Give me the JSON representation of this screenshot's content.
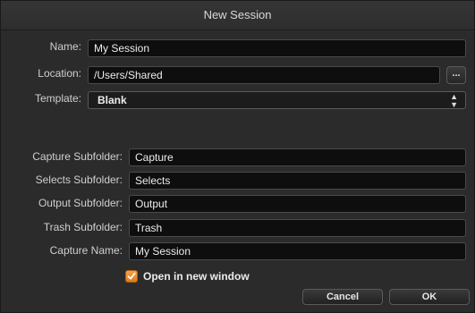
{
  "dialog": {
    "title": "New Session"
  },
  "form": {
    "name_label": "Name:",
    "name_value": "My Session",
    "location_label": "Location:",
    "location_value": "/Users/Shared",
    "browse_label": "...",
    "template_label": "Template:",
    "template_value": "Blank",
    "capture_subfolder_label": "Capture Subfolder:",
    "capture_subfolder_value": "Capture",
    "selects_subfolder_label": "Selects Subfolder:",
    "selects_subfolder_value": "Selects",
    "output_subfolder_label": "Output Subfolder:",
    "output_subfolder_value": "Output",
    "trash_subfolder_label": "Trash Subfolder:",
    "trash_subfolder_value": "Trash",
    "capture_name_label": "Capture Name:",
    "capture_name_value": "My Session",
    "open_new_window_label": "Open in new window",
    "open_new_window_checked": true
  },
  "buttons": {
    "cancel": "Cancel",
    "ok": "OK"
  },
  "colors": {
    "background": "#2b2b2b",
    "field_bg": "#0e0e0e",
    "checkbox_accent": "#e88a2a"
  },
  "icons": {
    "checkmark": "checkmark-icon",
    "select_arrows": "up-down-arrows-icon"
  }
}
